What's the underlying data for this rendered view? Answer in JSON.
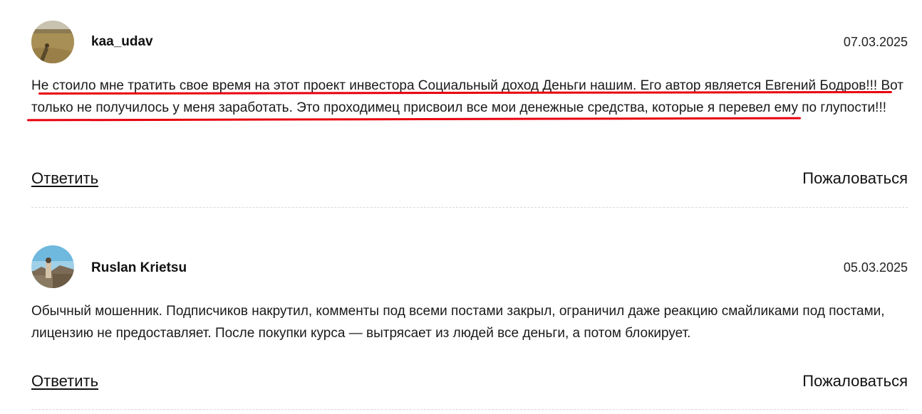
{
  "comments": [
    {
      "author": "kaa_udav",
      "date": "07.03.2025",
      "text": "Не стоило мне тратить свое время на этот проект инвестора Социальный доход Деньги нашим. Его автор является Евгений Бодров!!! Вот только не получилось у меня заработать. Это проходимец присвоил все мои денежные средства, которые я перевел ему по глупости!!!",
      "reply_label": "Ответить",
      "report_label": "Пожаловаться",
      "avatar_icon": "field-landscape-photo"
    },
    {
      "author": "Ruslan Krietsu",
      "date": "05.03.2025",
      "text": "Обычный мошенник. Подписчиков накрутил, комменты под всеми постами закрыл, ограничил даже реакцию смайликами под постами, лицензию не предоставляет. После покупки курса — вытрясает из людей все деньги, а потом блокирует.",
      "reply_label": "Ответить",
      "report_label": "Пожаловаться",
      "avatar_icon": "person-sky-photo"
    }
  ],
  "highlight_color": "#e8000d"
}
